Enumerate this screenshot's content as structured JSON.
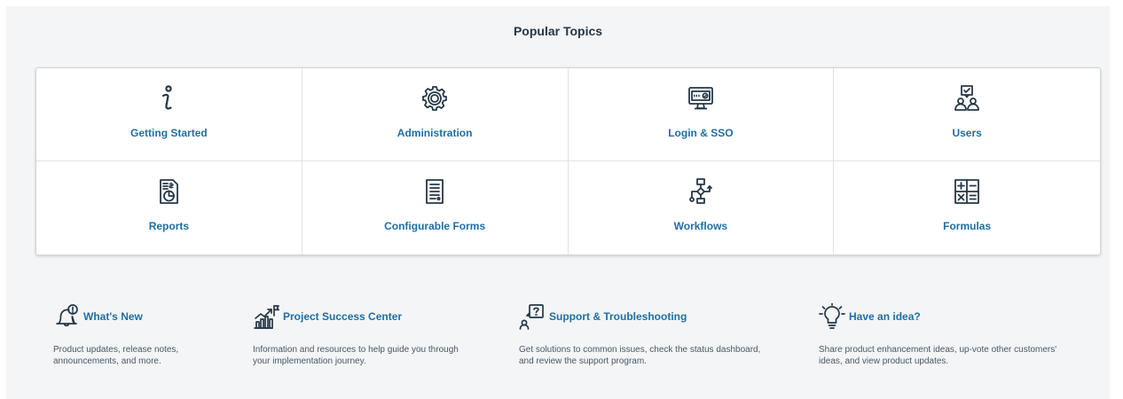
{
  "popular_topics": {
    "title": "Popular Topics",
    "tiles": [
      {
        "label": "Getting Started",
        "icon": "info-icon"
      },
      {
        "label": "Administration",
        "icon": "gear-icon"
      },
      {
        "label": "Login & SSO",
        "icon": "monitor-login-icon"
      },
      {
        "label": "Users",
        "icon": "users-icon"
      },
      {
        "label": "Reports",
        "icon": "report-icon"
      },
      {
        "label": "Configurable Forms",
        "icon": "form-icon"
      },
      {
        "label": "Workflows",
        "icon": "workflow-icon"
      },
      {
        "label": "Formulas",
        "icon": "calculator-icon"
      }
    ]
  },
  "features": [
    {
      "title": "What's New",
      "icon": "bell-icon",
      "desc_line1": "Product updates, release notes,",
      "desc_line2": "announcements, and more."
    },
    {
      "title": "Project Success Center",
      "icon": "growth-flag-icon",
      "desc_line1": "Information and resources to help guide you through",
      "desc_line2": "your implementation journey."
    },
    {
      "title": "Support & Troubleshooting",
      "icon": "support-question-icon",
      "desc_line1": "Get solutions to common issues, check the status dashboard,",
      "desc_line2": "and review the support program."
    },
    {
      "title": "Have an idea?",
      "icon": "lightbulb-icon",
      "desc_line1": "Share product enhancement ideas, up-vote other customers'",
      "desc_line2": "ideas, and view product updates."
    }
  ],
  "colors": {
    "link": "#1d6fa4",
    "icon": "#253746",
    "panel_bg": "#f4f5f6"
  }
}
